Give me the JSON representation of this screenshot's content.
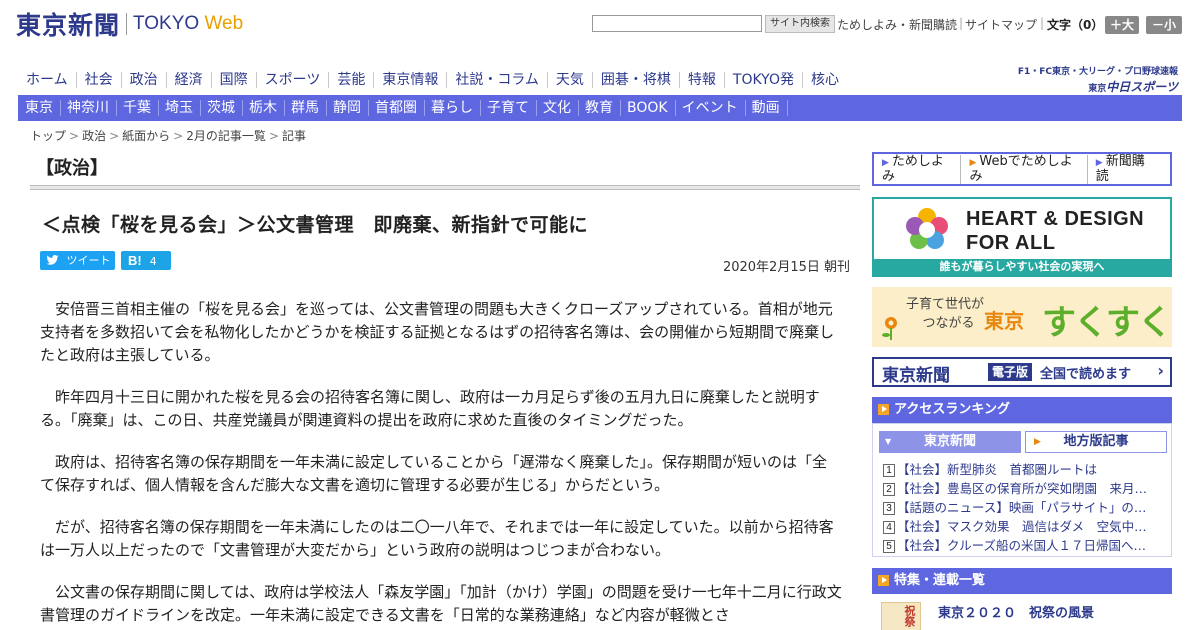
{
  "header": {
    "logo_jp": "東京新聞",
    "logo_en": "TOKYO",
    "logo_web": "Web",
    "search_button": "サイト内検索",
    "links": [
      "ためしよみ・新聞購読",
      "サイトマップ"
    ],
    "font_size_label": "文字（0）",
    "font_larger": "＋大",
    "font_smaller": "－小"
  },
  "nav_main": [
    "ホーム",
    "社会",
    "政治",
    "経済",
    "国際",
    "スポーツ",
    "芸能",
    "東京情報",
    "社説・コラム",
    "天気",
    "囲碁・将棋",
    "特報",
    "TOKYO発",
    "核心"
  ],
  "chunichi": {
    "line1": "F1・FC東京・大リーグ・プロ野球速報",
    "line2_small": "東京",
    "line2": "中日スポーツ"
  },
  "nav_local": [
    "東京",
    "神奈川",
    "千葉",
    "埼玉",
    "茨城",
    "栃木",
    "群馬",
    "静岡",
    "首都圏",
    "暮らし",
    "子育て",
    "文化",
    "教育",
    "BOOK",
    "イベント",
    "動画"
  ],
  "breadcrumb": [
    "トップ",
    "政治",
    "紙面から",
    "2月の記事一覧",
    "記事"
  ],
  "article": {
    "section": "【政治】",
    "headline": "＜点検「桜を見る会」＞公文書管理　即廃棄、新指針で可能に",
    "tweet_label": "ツイート",
    "hatena_label": "B!",
    "hatena_count": "4",
    "dateline": "2020年2月15日 朝刊",
    "paragraphs": [
      "安倍晋三首相主催の「桜を見る会」を巡っては、公文書管理の問題も大きくクローズアップされている。首相が地元支持者を多数招いて会を私物化したかどうかを検証する証拠となるはずの招待客名簿は、会の開催から短期間で廃棄したと政府は主張している。",
      "昨年四月十三日に開かれた桜を見る会の招待客名簿に関し、政府は一カ月足らず後の五月九日に廃棄したと説明する。「廃棄」は、この日、共産党議員が関連資料の提出を政府に求めた直後のタイミングだった。",
      "政府は、招待客名簿の保存期間を一年未満に設定していることから「遅滞なく廃棄した」。保存期間が短いのは「全て保存すれば、個人情報を含んだ膨大な文書を適切に管理する必要が生じる」からだという。",
      "だが、招待客名簿の保存期間を一年未満にしたのは二〇一八年で、それまでは一年に設定していた。以前から招待客は一万人以上だったので「文書管理が大変だから」という政府の説明はつじつまが合わない。",
      "公文書の保存期間に関しては、政府は学校法人「森友学園」「加計（かけ）学園」の問題を受け一七年十二月に行政文書管理のガイドラインを改定。一年未満に設定できる文書を「日常的な業務連絡」など内容が軽微とさ"
    ]
  },
  "sidebar": {
    "links": [
      "ためしよみ",
      "Webでためしよみ",
      "新聞購読"
    ],
    "heart_title_1": "HEART & DESIGN",
    "heart_title_2": "FOR ALL",
    "heart_footer": "誰もが暮らしやすい社会の実現へ",
    "suku_small_1": "子育て世代が",
    "suku_small_2": "つながる",
    "suku_big_1": "東京",
    "suku_big_2": "すくすく",
    "epaper_logo": "東京新聞",
    "epaper_tag": "電子版",
    "epaper_text": "全国で読めます",
    "ranking_title": "アクセスランキング",
    "ranking_tab_1": "東京新聞",
    "ranking_tab_2": "地方版記事",
    "ranking": [
      {
        "num": "1",
        "text": "【社会】新型肺炎　首都圏ルートは"
      },
      {
        "num": "2",
        "text": "【社会】豊島区の保育所が突如閉園　来月…"
      },
      {
        "num": "3",
        "text": "【話題のニュース】映画「パラサイト」の…"
      },
      {
        "num": "4",
        "text": "【社会】マスク効果　過信はダメ　空気中…"
      },
      {
        "num": "5",
        "text": "【社会】クルーズ船の米国人１７日帰国へ…"
      }
    ],
    "feature_title": "特集・連載一覧",
    "feature_thumb": "祝祭",
    "feature_item": "東京２０２０　祝祭の風景"
  },
  "colors": {
    "brand": "#2d3a8c",
    "nav_bar": "#5e67e0",
    "accent_orange": "#e8860e",
    "teal": "#27a9a2"
  }
}
